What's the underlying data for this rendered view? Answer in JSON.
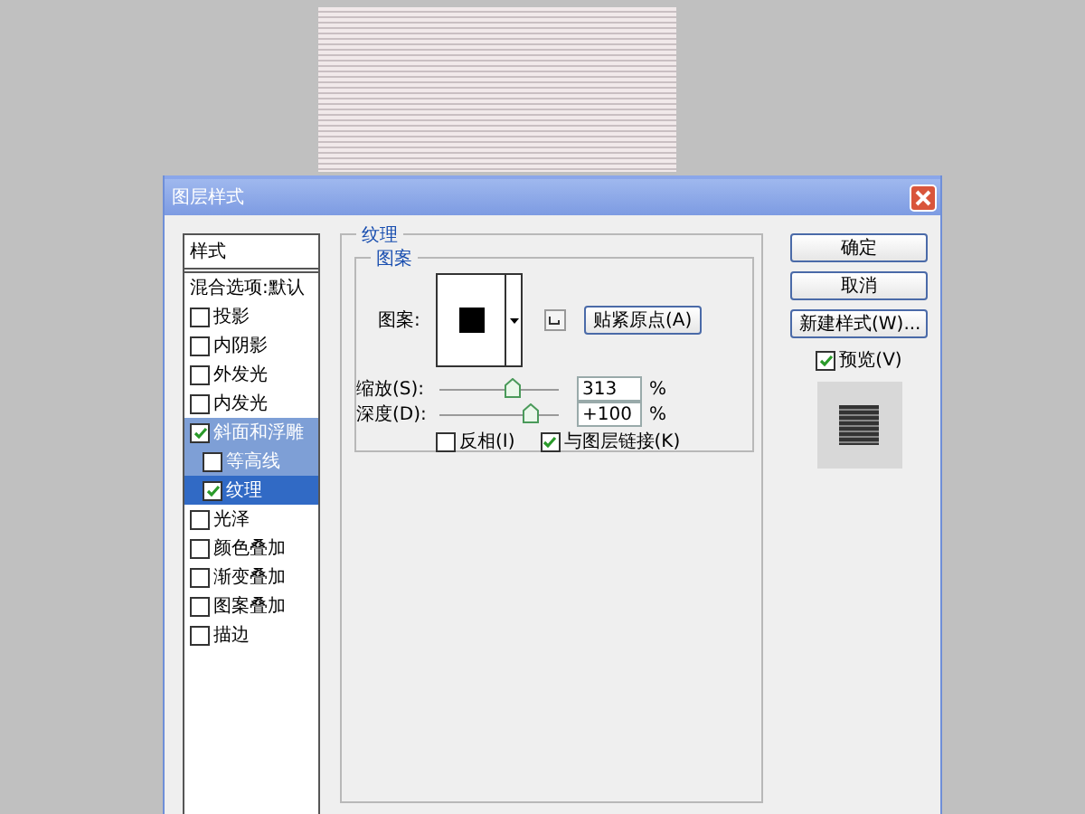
{
  "window": {
    "title": "图层样式"
  },
  "sidebar": {
    "header": "样式",
    "items": [
      {
        "label": "混合选项:默认",
        "kind": "plain",
        "selected": false
      },
      {
        "label": "投影",
        "kind": "check",
        "checked": false,
        "selected": false,
        "expanded": false
      },
      {
        "label": "内阴影",
        "kind": "check",
        "checked": false,
        "selected": false,
        "expanded": false
      },
      {
        "label": "外发光",
        "kind": "check",
        "checked": false,
        "selected": false,
        "expanded": false
      },
      {
        "label": "内发光",
        "kind": "check",
        "checked": false,
        "selected": false,
        "expanded": false
      },
      {
        "label": "斜面和浮雕",
        "kind": "check",
        "checked": true,
        "selected": false,
        "expanded": true,
        "children": [
          {
            "label": "等高线",
            "kind": "check",
            "checked": false,
            "selected": false
          },
          {
            "label": "纹理",
            "kind": "check",
            "checked": true,
            "selected": true
          }
        ]
      },
      {
        "label": "光泽",
        "kind": "check",
        "checked": false,
        "selected": false,
        "expanded": false
      },
      {
        "label": "颜色叠加",
        "kind": "check",
        "checked": false,
        "selected": false,
        "expanded": false
      },
      {
        "label": "渐变叠加",
        "kind": "check",
        "checked": false,
        "selected": false,
        "expanded": false
      },
      {
        "label": "图案叠加",
        "kind": "check",
        "checked": false,
        "selected": false,
        "expanded": false
      },
      {
        "label": "描边",
        "kind": "check",
        "checked": false,
        "selected": false,
        "expanded": false
      }
    ]
  },
  "section": {
    "title": "纹理",
    "group_title": "图案",
    "pattern_label": "图案:",
    "snap_button": "贴紧原点(A)",
    "sliders": [
      {
        "label": "缩放(S):",
        "level": 0.61,
        "value": "313",
        "unit": "%"
      },
      {
        "label": "深度(D):",
        "level": 0.76,
        "value": "+100",
        "unit": "%"
      }
    ],
    "checkboxes": [
      {
        "label": "反相(I)",
        "checked": false
      },
      {
        "label": "与图层链接(K)",
        "checked": true
      }
    ]
  },
  "buttons": [
    "确定",
    "取消",
    "新建样式(W)..."
  ],
  "preview": {
    "label": "预览(V)",
    "checked": true
  }
}
